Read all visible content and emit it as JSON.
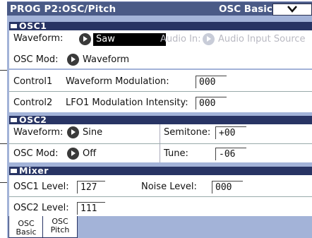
{
  "header": {
    "title": "PROG P2:OSC/Pitch",
    "page_name": "OSC Basic"
  },
  "osc1": {
    "title": "OSC1",
    "waveform_label": "Waveform:",
    "waveform_value": "Saw",
    "audio_in_label": "Audio In:",
    "audio_input_source": "Audio Input Source",
    "osc_mod_label": "OSC Mod:",
    "osc_mod_value": "Waveform",
    "control1_label": "Control1",
    "control1_name": "Waveform Modulation:",
    "control1_value": "000",
    "control2_label": "Control2",
    "control2_name": "LFO1 Modulation Intensity:",
    "control2_value": "000"
  },
  "osc2": {
    "title": "OSC2",
    "waveform_label": "Waveform:",
    "waveform_value": "Sine",
    "semitone_label": "Semitone:",
    "semitone_value": "+00",
    "osc_mod_label": "OSC Mod:",
    "osc_mod_value": "Off",
    "tune_label": "Tune:",
    "tune_value": "-06"
  },
  "mixer": {
    "title": "Mixer",
    "osc1_level_label": "OSC1 Level:",
    "osc1_level_value": "127",
    "noise_level_label": "Noise Level:",
    "noise_level_value": "000",
    "osc2_level_label": "OSC2 Level:",
    "osc2_level_value": "111"
  },
  "tabs": [
    {
      "line1": "OSC",
      "line2": "Basic"
    },
    {
      "line1": "OSC",
      "line2": "Pitch"
    }
  ],
  "colors": {
    "title_bar": "#4a5a86",
    "section_bar": "#283464",
    "background_panel": "#a3b3d8"
  }
}
